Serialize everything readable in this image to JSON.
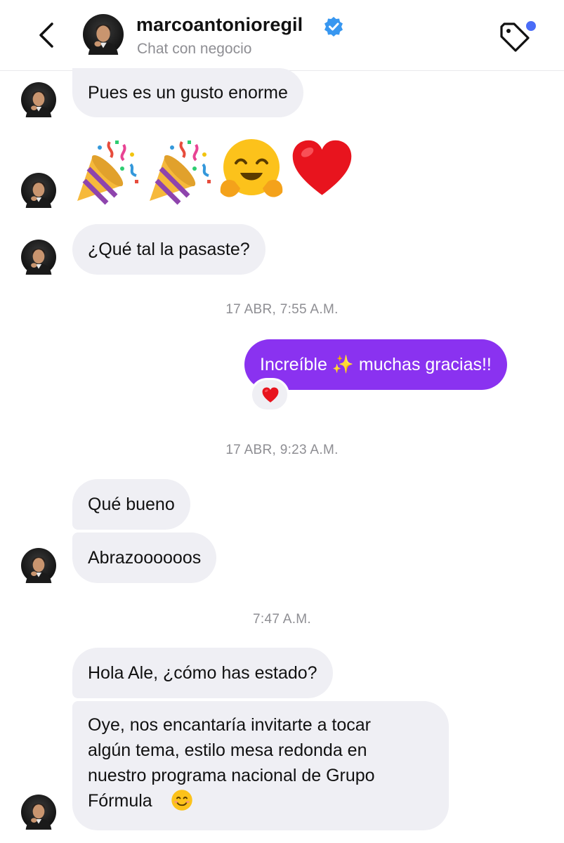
{
  "header": {
    "back_icon": "chevron-left-icon",
    "username": "marcoantonioregil",
    "verified_icon": "verified-badge-icon",
    "subtitle": "Chat con negocio",
    "tag_icon": "tag-icon",
    "accent_color": "#8a32f0",
    "verified_color": "#3897f0"
  },
  "messages": {
    "m1": "Pues es un gusto enorme",
    "emojis": [
      "party-popper-emoji",
      "party-popper-emoji",
      "hugging-face-emoji",
      "red-heart-emoji"
    ],
    "m2": "¿Qué tal la pasaste?",
    "ts1": "17 ABR, 7:55 A.M.",
    "out1": "Increíble ✨ muchas gracias!!",
    "out1_reaction": "red-heart-emoji",
    "ts2": "17 ABR, 9:23 A.M.",
    "m3": "Qué bueno",
    "m4": "Abrazoooooos",
    "ts3": "7:47 A.M.",
    "m5": "Hola Ale, ¿cómo has estado?",
    "m6_lines": [
      "Oye, nos encantaría invitarte a tocar",
      "algún tema, estilo mesa redonda en",
      "nuestro programa nacional de Grupo",
      "Fórmula"
    ],
    "m6_emoji": "smiling-face-emoji"
  }
}
